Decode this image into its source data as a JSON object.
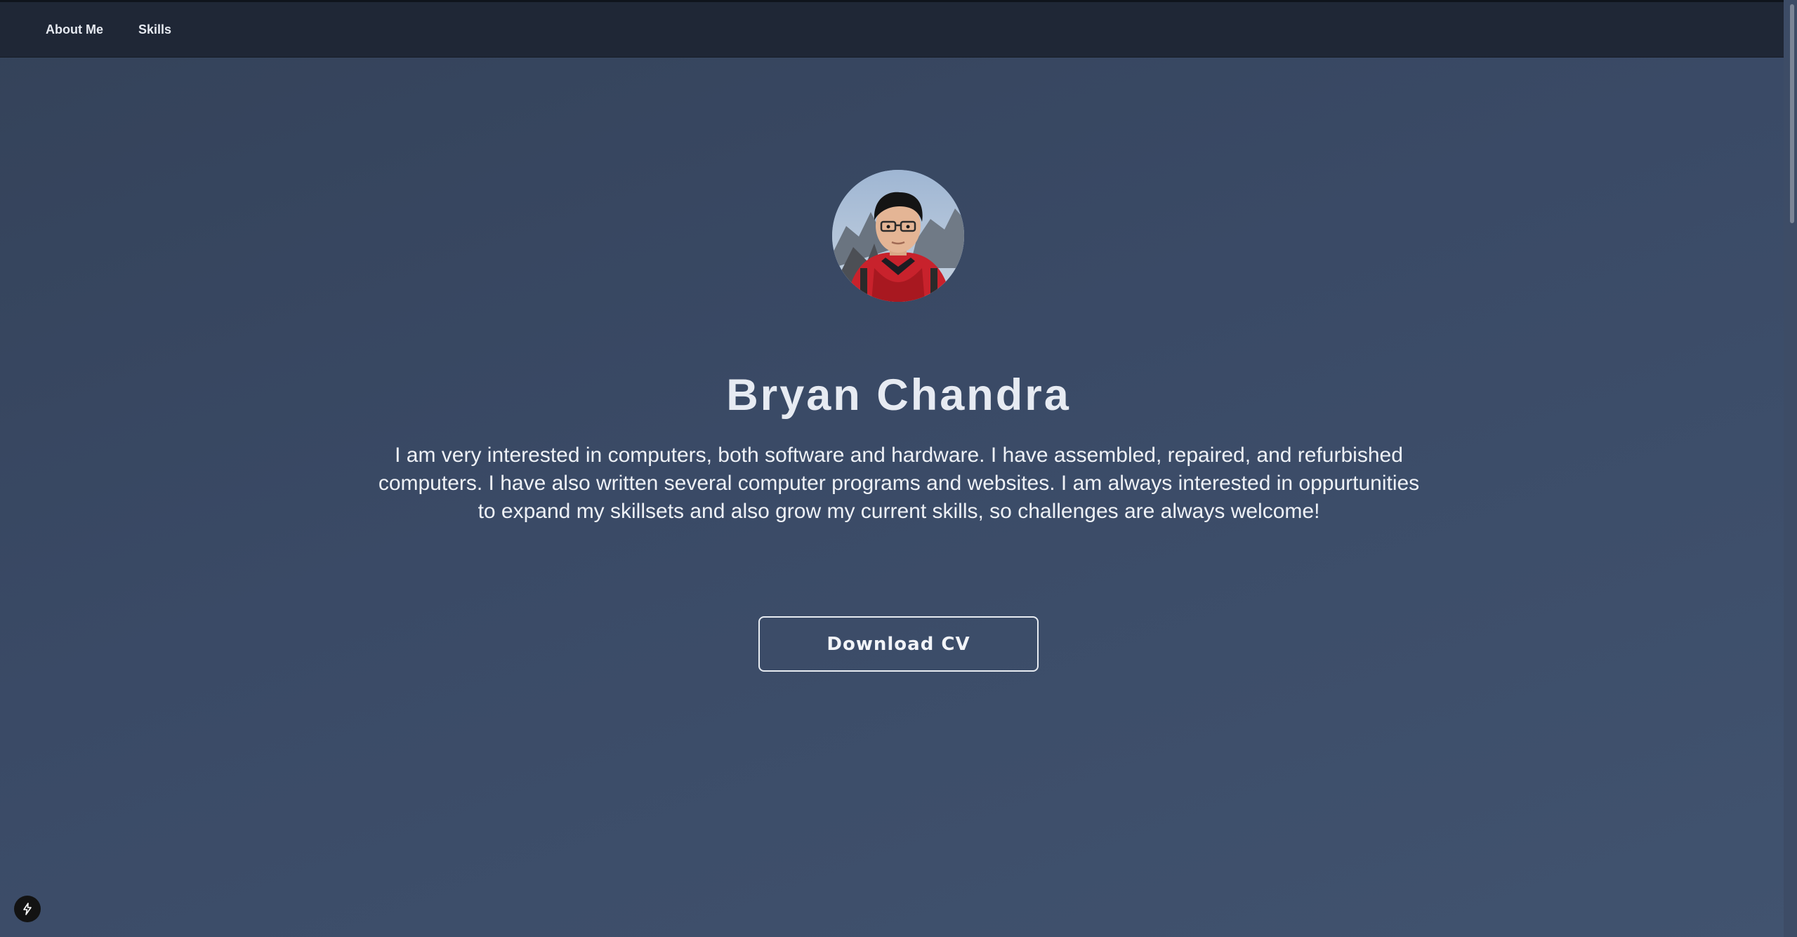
{
  "nav": {
    "items": [
      {
        "label": "About Me"
      },
      {
        "label": "Skills"
      }
    ]
  },
  "profile": {
    "name": "Bryan Chandra",
    "bio": "I am very interested in computers, both software and hardware. I have assembled, repaired, and refurbished computers. I have also written several computer programs and websites. I am always interested in oppurtunities to expand my skillsets and also grow my current skills, so challenges are always welcome!",
    "avatar_description": "profile-photo"
  },
  "actions": {
    "download_cv_label": "Download CV"
  },
  "icons": {
    "badge": "lightning-icon"
  },
  "colors": {
    "navbar": "#1f2736",
    "background_start": "#344259",
    "background_end": "#41536f",
    "text": "#e7ebf2"
  }
}
